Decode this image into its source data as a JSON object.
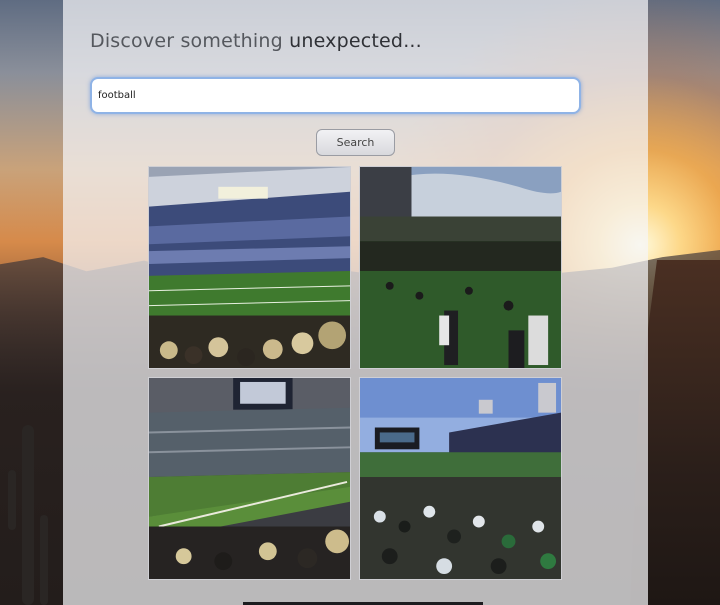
{
  "header": {
    "headline_prefix": "Discover something",
    "headline_emphasis": "unexpected..."
  },
  "search": {
    "query": "football",
    "button_label": "Search"
  },
  "results": [
    {
      "name": "football-photo-1"
    },
    {
      "name": "football-photo-2"
    },
    {
      "name": "football-photo-3"
    },
    {
      "name": "football-photo-4"
    }
  ]
}
